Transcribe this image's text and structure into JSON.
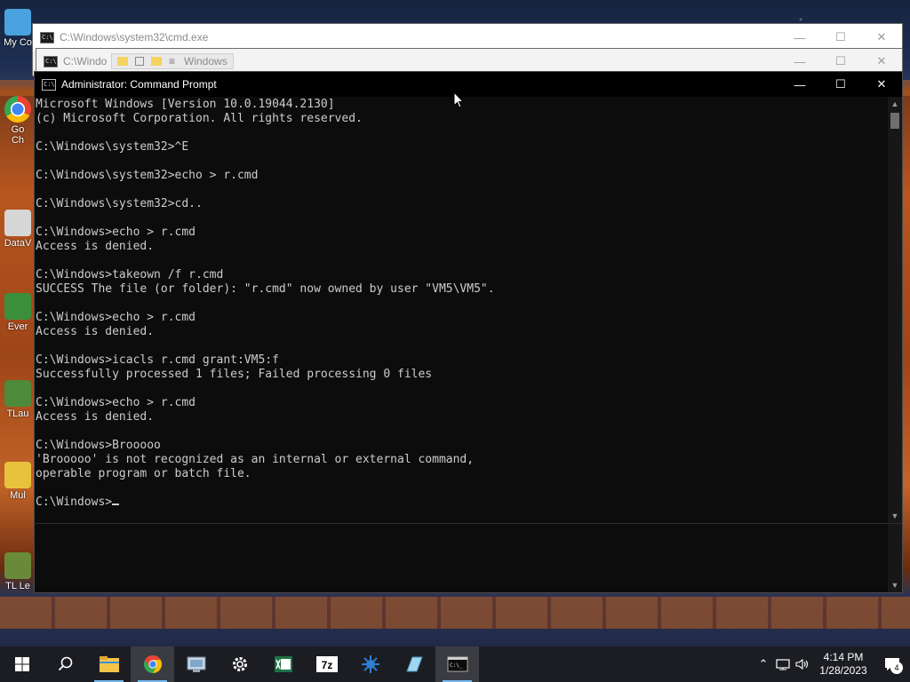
{
  "desktop": {
    "icons": [
      {
        "label": "My Co"
      },
      {
        "label": "Go\nCh"
      },
      {
        "label": "DataV"
      },
      {
        "label": "Ever"
      },
      {
        "label": "TLau"
      },
      {
        "label": "Mul"
      },
      {
        "label": "TL Le"
      }
    ]
  },
  "back_window_1": {
    "title": "C:\\Windows\\system32\\cmd.exe"
  },
  "back_window_2": {
    "title": "C:\\Windo",
    "explorer_title": "Windows"
  },
  "main_window": {
    "title": "Administrator: Command Prompt",
    "lines": [
      "Microsoft Windows [Version 10.0.19044.2130]",
      "(c) Microsoft Corporation. All rights reserved.",
      "",
      "C:\\Windows\\system32>^E",
      "",
      "C:\\Windows\\system32>echo > r.cmd",
      "",
      "C:\\Windows\\system32>cd..",
      "",
      "C:\\Windows>echo > r.cmd",
      "Access is denied.",
      "",
      "C:\\Windows>takeown /f r.cmd",
      "SUCCESS The file (or folder): \"r.cmd\" now owned by user \"VM5\\VM5\".",
      "",
      "C:\\Windows>echo > r.cmd",
      "Access is denied.",
      "",
      "C:\\Windows>icacls r.cmd grant:VM5:f",
      "Successfully processed 1 files; Failed processing 0 files",
      "",
      "C:\\Windows>echo > r.cmd",
      "Access is denied.",
      "",
      "C:\\Windows>Brooooo",
      "'Brooooo' is not recognized as an internal or external command,",
      "operable program or batch file.",
      ""
    ],
    "prompt": "C:\\Windows>"
  },
  "taskbar": {
    "apps": [
      {
        "name": "search-icon"
      },
      {
        "name": "file-explorer-icon"
      },
      {
        "name": "chrome-icon"
      },
      {
        "name": "control-panel-icon"
      },
      {
        "name": "settings-gear-icon"
      },
      {
        "name": "excel-sheet-icon"
      },
      {
        "name": "7zip-icon"
      },
      {
        "name": "network-tool-icon"
      },
      {
        "name": "notepad-icon"
      },
      {
        "name": "command-prompt-icon"
      }
    ],
    "clock_time": "4:14 PM",
    "clock_date": "1/28/2023",
    "notification_count": "4"
  },
  "colors": {
    "console_bg": "#0c0c0c",
    "console_fg": "#cccccc",
    "taskbar_bg": "#1c1d22",
    "accent": "#76b9ed"
  }
}
